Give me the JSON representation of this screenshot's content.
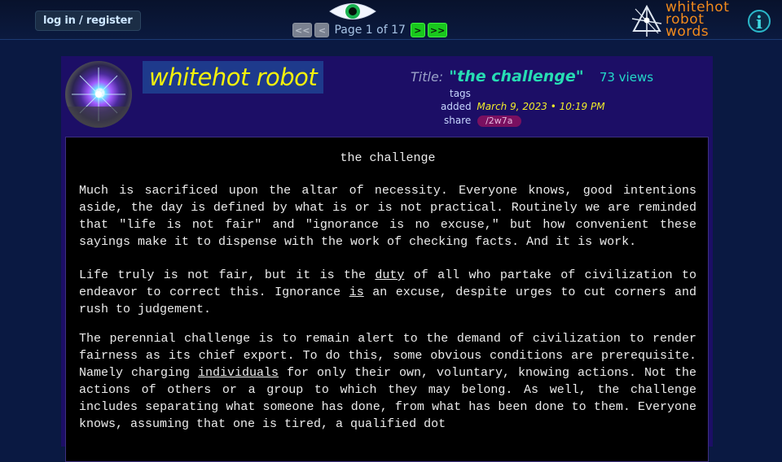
{
  "header": {
    "login_label": "log in / register",
    "pager": {
      "first_label": "<<",
      "prev_label": "<",
      "page_text": "Page 1 of 17",
      "next_label": ">",
      "last_label": ">>"
    },
    "logo_words": [
      "whitehot",
      "robot",
      "words"
    ],
    "info_label": "i"
  },
  "post": {
    "author": "whitehot robot",
    "title_label": "Title:",
    "title": "\"the challenge\"",
    "views": "73 views",
    "tags_label": "tags",
    "added_label": "added",
    "added_date": "March 9, 2023 • 10:19 PM",
    "share_label": "share",
    "share_code": "/2w7a",
    "heading": "the challenge",
    "p1": "Much is sacrificed upon the altar of necessity. Everyone knows, good intentions aside, the day is defined by what is or is not practical. Routinely we are reminded that \"life is not fair\" and \"ignorance is no excuse,\" but how convenient these sayings make it to dispense with the work of checking facts. And it is work.",
    "p2_a": "Life truly is not fair, but it is the ",
    "p2_u1": "duty",
    "p2_b": " of all who partake of civilization to endeavor to correct this. Ignorance ",
    "p2_u2": "is",
    "p2_c": " an excuse, despite urges to cut corners and rush to judgement.",
    "p3_a": "The perennial challenge is to remain alert to the demand of civilization to render fairness as its chief export. To do this, some obvious conditions are prerequisite. Namely charging ",
    "p3_u": "individuals",
    "p3_b": " for only their own, voluntary, knowing actions. Not the actions of others or a group to which they may belong. As well, the challenge includes separating what someone has done, from what has been done to them. Everyone knows, assuming that one is tired, a qualified dot"
  }
}
